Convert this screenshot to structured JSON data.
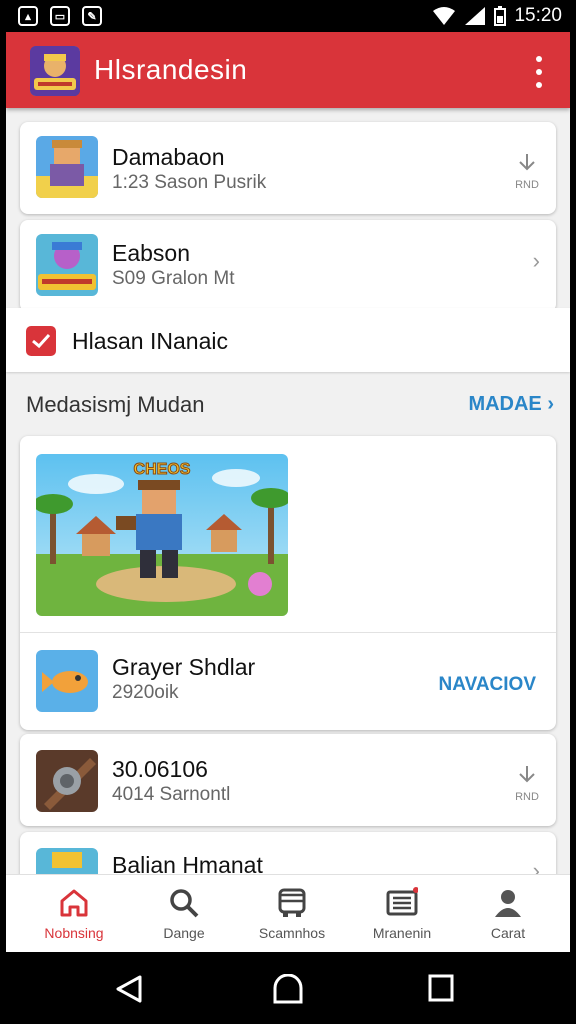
{
  "status_bar": {
    "time": "15:20"
  },
  "app_bar": {
    "title": "Hlsrandesin"
  },
  "list_top": [
    {
      "title": "Damabaon",
      "subtitle": "1:23 Sason Pusrik",
      "action_label": "RND",
      "icon": "download-icon"
    },
    {
      "title": "Eabson",
      "subtitle": "S09 Gralon Mt",
      "icon": "chevron-right-icon"
    }
  ],
  "checkbox_row": {
    "label": "Hlasan INanaic",
    "checked": true
  },
  "section": {
    "title": "Medasismj Mudan",
    "more_label": "MADAE"
  },
  "featured": {
    "banner_text": "CHEOS",
    "item_title": "Grayer Shdlar",
    "item_subtitle": "2920oik",
    "action_label": "NAVACIOV"
  },
  "list_bottom": [
    {
      "title": "30.06106",
      "subtitle": "4014 Sarnontl",
      "action_label": "RND",
      "icon": "download-icon"
    },
    {
      "title": "Balian Hmanat",
      "icon": "chevron-right-icon"
    }
  ],
  "bottom_nav": [
    {
      "label": "Nobnsing",
      "icon": "home-icon",
      "active": true
    },
    {
      "label": "Dange",
      "icon": "search-icon",
      "active": false
    },
    {
      "label": "Scamnhos",
      "icon": "bus-icon",
      "active": false
    },
    {
      "label": "Mranenin",
      "icon": "news-icon",
      "active": false
    },
    {
      "label": "Carat",
      "icon": "person-icon",
      "active": false
    }
  ],
  "colors": {
    "accent": "#d9343a",
    "link": "#2a86c8",
    "background": "#f1f1f1"
  }
}
